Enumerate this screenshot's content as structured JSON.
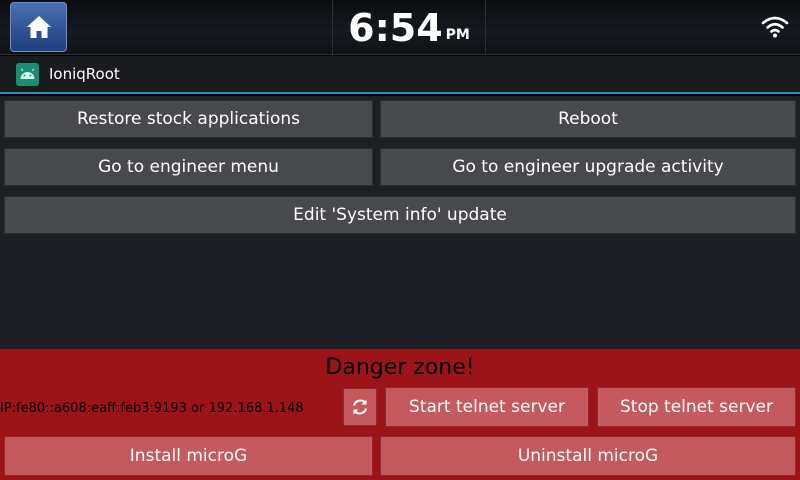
{
  "statusbar": {
    "home_icon": "home-icon",
    "time": "6:54",
    "ampm": "PM",
    "wifi_icon": "wifi-icon"
  },
  "app": {
    "title": "IoniqRoot",
    "icon": "android-icon"
  },
  "main": {
    "buttons": {
      "restore": "Restore stock applications",
      "reboot": "Reboot",
      "engineer_menu": "Go to engineer menu",
      "engineer_upgrade": "Go to engineer upgrade activity",
      "edit_sysinfo": "Edit 'System info' update"
    }
  },
  "danger": {
    "title": "Danger zone!",
    "ip": "IP:fe80::a608:eaff:feb3:9193 or 192.168.1.148",
    "refresh_icon": "refresh-icon",
    "start_telnet": "Start telnet server",
    "stop_telnet": "Stop telnet server",
    "install_microg": "Install microG",
    "uninstall_microg": "Uninstall microG"
  },
  "colors": {
    "danger_bg": "#9c1418",
    "button_bg": "#47494c",
    "danger_button_bg": "#c45a5d",
    "accent_line": "#2d8fbf"
  }
}
